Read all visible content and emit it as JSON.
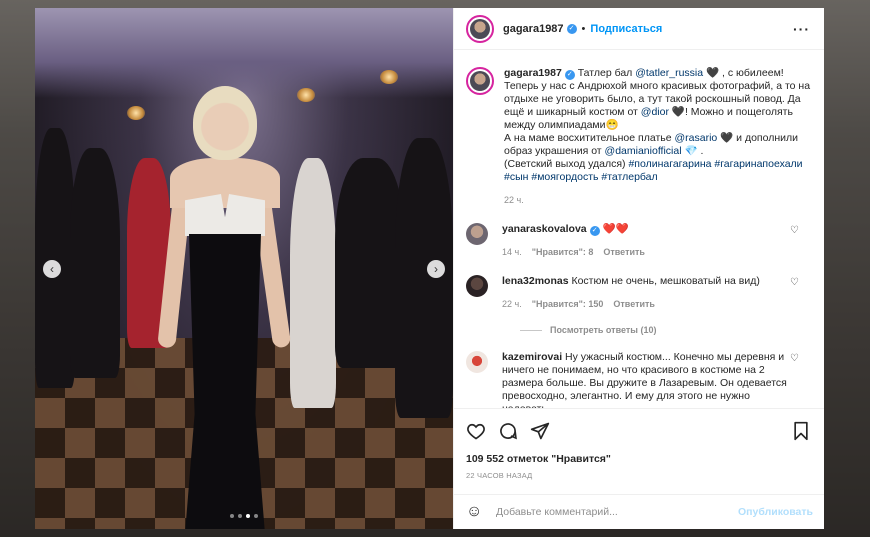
{
  "post": {
    "username": "gagara1987",
    "follow_label": "Подписаться",
    "caption_lines": [
      [
        "Татлер бал ",
        "@tatler_russia",
        " 🖤 , с юбилеем!"
      ],
      [
        "Теперь у нас с Андрюхой много красивых фотографий, а то на"
      ],
      [
        "отдыхе не уговорить было, а тут такой роскошный повод. Да"
      ],
      [
        "ещё и шикарный костюм от ",
        "@dior",
        " 🖤! Можно и пощеголять"
      ],
      [
        "между олимпиадами😁"
      ],
      [
        "А на маме восхитительное платье ",
        "@rasario",
        " 🖤 и дополнили"
      ],
      [
        "образ украшения от ",
        "@damianiofficial",
        " 💎 ."
      ],
      [
        "(Светский выход удался) ",
        "#полинагагарина #гагаринапоехали"
      ],
      [
        "",
        "#сын #моягордость #татлербал"
      ]
    ],
    "caption_time": "22 ч.",
    "likes": "109 552 отметок \"Нравится\"",
    "time_ago": "22 ЧАСОВ НАЗАД",
    "comment_placeholder": "Добавьте комментарий...",
    "publish_label": "Опубликовать"
  },
  "comments": [
    {
      "username": "yanaraskovalova",
      "verified": true,
      "text": "❤️❤️",
      "time": "14 ч.",
      "likes": "\"Нравится\": 8",
      "reply": "Ответить"
    },
    {
      "username": "lena32monas",
      "verified": false,
      "text": "Костюм не очень, мешковатый на вид)",
      "time": "22 ч.",
      "likes": "\"Нравится\": 150",
      "reply": "Ответить",
      "view_replies": "Посмотреть ответы (10)"
    },
    {
      "username": "kazemirovai",
      "verified": false,
      "text": "Ну ужасный костюм... Конечно мы деревня и ничего не понимаем, но что красивого в костюме на 2 размера больше. Вы дружите в Лазаревым. Он одевается превосходно, элегантно. И ему для этого не нужно надевать"
    }
  ],
  "carousel": {
    "total": 4,
    "active": 2
  },
  "icons": [
    "heart-icon",
    "comment-icon",
    "share-icon",
    "bookmark-icon",
    "more-icon",
    "smile-icon",
    "chevron-left-icon",
    "chevron-right-icon",
    "verified-icon"
  ],
  "colors": {
    "accent": "#0095f6",
    "verified": "#3897f0",
    "muted": "#8e8e8e"
  }
}
